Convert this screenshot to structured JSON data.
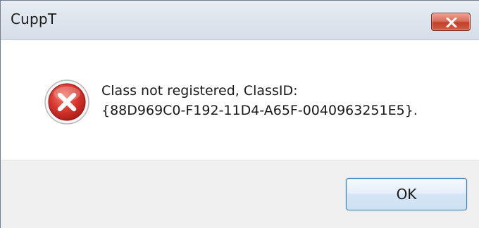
{
  "window": {
    "title": "CuppT",
    "close_icon": "close-icon"
  },
  "message": {
    "icon": "error-icon",
    "line1": "Class not registered, ClassID:",
    "line2": "{88D969C0-F192-11D4-A65F-0040963251E5}."
  },
  "buttons": {
    "ok_label": "OK"
  },
  "colors": {
    "error_red": "#d2322d",
    "close_button": "#c9503a",
    "ok_border": "#3c7fb1",
    "footer_bg": "#f0f0f0"
  }
}
